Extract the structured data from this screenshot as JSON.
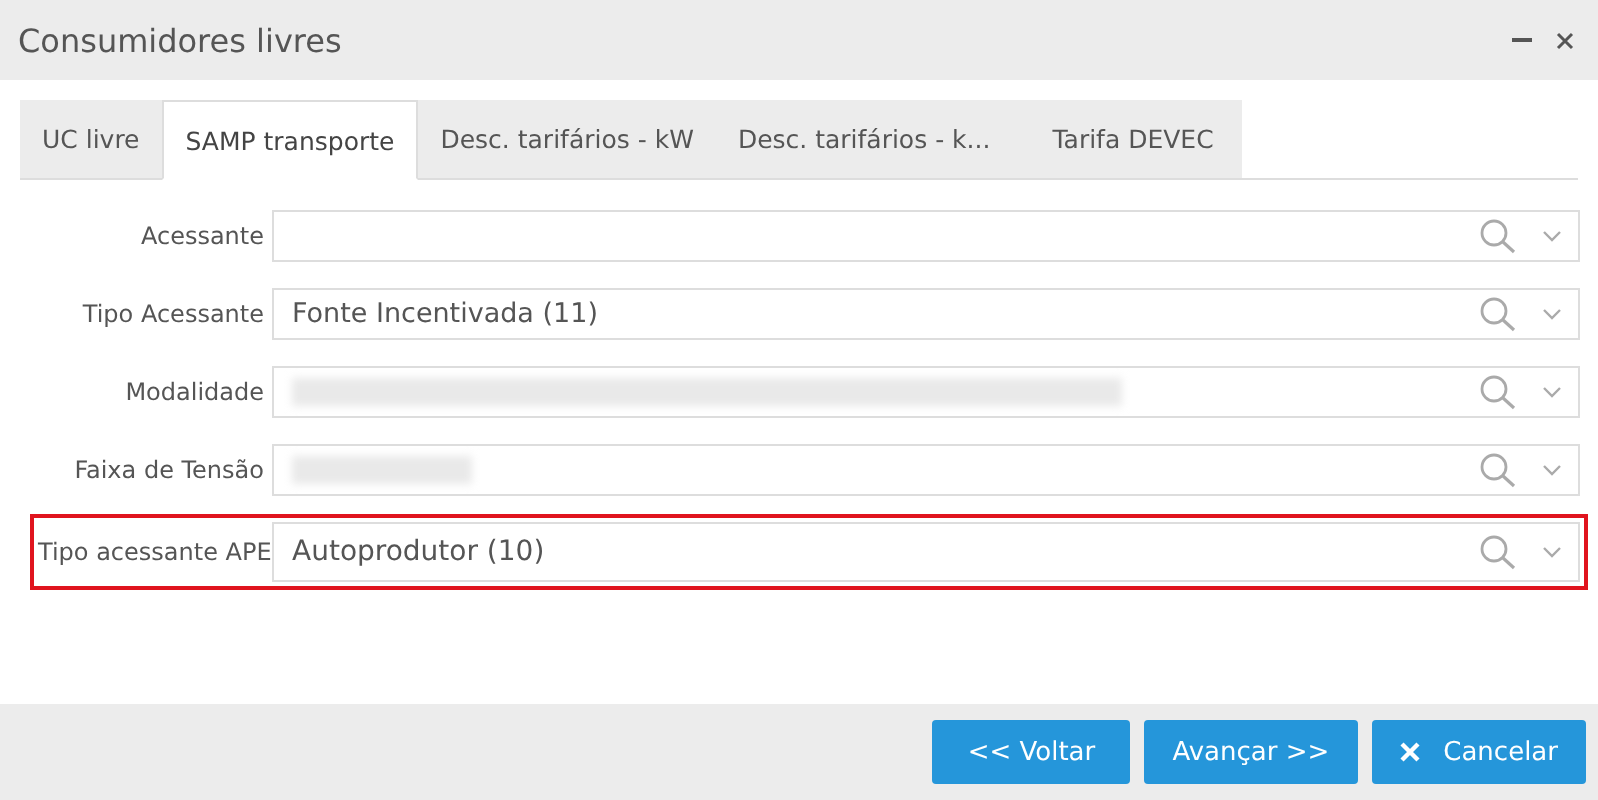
{
  "window": {
    "title": "Consumidores livres"
  },
  "tabs": [
    {
      "label": "UC livre",
      "selected": false
    },
    {
      "label": "SAMP transporte",
      "selected": true
    },
    {
      "label": "Desc. tarifários - kW",
      "selected": false
    },
    {
      "label": "Desc. tarifários - k...",
      "selected": false
    },
    {
      "label": "Tarifa DEVEC",
      "selected": false
    }
  ],
  "fields": [
    {
      "label": "Acessante",
      "kind": "empty",
      "highlighted": false
    },
    {
      "label": "Tipo Acessante",
      "kind": "text",
      "value": "Fonte Incentivada (11)",
      "highlighted": false
    },
    {
      "label": "Modalidade",
      "kind": "blurred",
      "highlighted": false
    },
    {
      "label": "Faixa de Tensão",
      "kind": "blurred",
      "highlighted": false
    },
    {
      "label": "Tipo acessante APE",
      "kind": "text",
      "value": "Autoprodutor (10)",
      "highlighted": true
    }
  ],
  "buttons": [
    {
      "label": "<< Voltar",
      "kind": "back"
    },
    {
      "label": "Avançar >>",
      "kind": "next"
    },
    {
      "label": "Cancelar",
      "kind": "cancel"
    }
  ]
}
